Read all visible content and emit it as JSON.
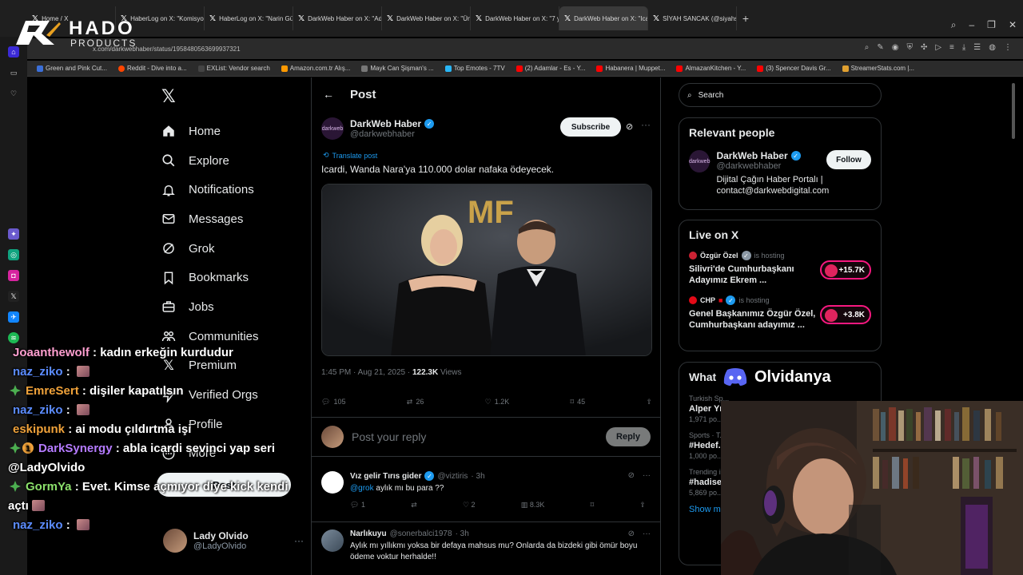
{
  "browser": {
    "tabs": [
      {
        "label": "Home / X"
      },
      {
        "label": "HaberLog on X: \"Komisyo"
      },
      {
        "label": "HaberLog on X: \"Narin Gü"
      },
      {
        "label": "DarkWeb Haber on X: \"Ad"
      },
      {
        "label": "DarkWeb Haber on X: \"Ün"
      },
      {
        "label": "DarkWeb Haber on X: \"7 y"
      },
      {
        "label": "DarkWeb Haber on X: \"Ica"
      },
      {
        "label": "SİYAH SANCAK (@siyahsa"
      }
    ],
    "url": "x.com/darkwebhaber/status/1958480563699937321",
    "bookmarks": [
      {
        "label": "Green and Pink Cut...",
        "color": "#3b6fd8"
      },
      {
        "label": "Reddit - Dive into a...",
        "color": "#ff4500"
      },
      {
        "label": "EXList: Vendor search",
        "color": "#444444"
      },
      {
        "label": "Amazon.com.tr Alış...",
        "color": "#ff9900"
      },
      {
        "label": "Mayk Can Şişman's ...",
        "color": "#777777"
      },
      {
        "label": "Top Emotes - 7TV",
        "color": "#29b6f6"
      },
      {
        "label": "(2) Adamlar - Es - Y...",
        "color": "#ff0000"
      },
      {
        "label": "Habanera | Muppet...",
        "color": "#ff0000"
      },
      {
        "label": "AlmazanKitchen - Y...",
        "color": "#ff0000"
      },
      {
        "label": "(3) Spencer Davis Gr...",
        "color": "#ff0000"
      },
      {
        "label": "StreamerStats.com |...",
        "color": "#e0a030"
      }
    ]
  },
  "logo": {
    "word": "HADO",
    "sub": "PRODUCTS"
  },
  "nav": {
    "items": [
      {
        "label": "Home",
        "icon": "home-icon"
      },
      {
        "label": "Explore",
        "icon": "search-icon"
      },
      {
        "label": "Notifications",
        "icon": "bell-icon"
      },
      {
        "label": "Messages",
        "icon": "envelope-icon"
      },
      {
        "label": "Grok",
        "icon": "grok-icon"
      },
      {
        "label": "Bookmarks",
        "icon": "bookmark-icon"
      },
      {
        "label": "Jobs",
        "icon": "briefcase-icon"
      },
      {
        "label": "Communities",
        "icon": "people-icon"
      },
      {
        "label": "Premium",
        "icon": "x-icon"
      },
      {
        "label": "Verified Orgs",
        "icon": "lightning-icon"
      },
      {
        "label": "Profile",
        "icon": "person-icon"
      },
      {
        "label": "More",
        "icon": "more-circle-icon"
      }
    ],
    "post_label": "Post",
    "profile": {
      "name": "Lady Olvido",
      "handle": "@LadyOlvido"
    }
  },
  "post": {
    "header_title": "Post",
    "author_name": "DarkWeb Haber",
    "author_handle": "@darkwebhaber",
    "avatar_text": "darkweb",
    "subscribe_label": "Subscribe",
    "translate_label": "Translate post",
    "text": "Icardi, Wanda Nara'ya 110.000 dolar nafaka ödeyecek.",
    "time": "1:45 PM · Aug 21, 2025 · ",
    "views": "122.3K",
    "views_label": " Views",
    "stats": {
      "replies": "105",
      "reposts": "26",
      "likes": "1.2K",
      "bookmarks": "45"
    },
    "image_text": "MF"
  },
  "reply_box": {
    "placeholder": "Post your reply",
    "button": "Reply"
  },
  "replies": [
    {
      "name": "Vız gelir Tırıs gider",
      "handle": "@viztiris",
      "time": "· 3h",
      "mention": "@grok",
      "text": " aylık mı bu para ??",
      "stats": {
        "replies": "1",
        "reposts": "",
        "likes": "2",
        "views": "8.3K"
      }
    },
    {
      "name": "Narlıkuyu",
      "handle": "@sonerbalci1978",
      "time": "· 3h",
      "mention": "",
      "text": "Aylık mı yıllıkmı yoksa bir defaya mahsus mu? Onlarda da bizdeki gibi ömür boyu ödeme voktur herhalde!!"
    }
  ],
  "right": {
    "search_placeholder": "Search",
    "relevant_title": "Relevant people",
    "relevant": {
      "name": "DarkWeb Haber",
      "handle": "@darkwebhaber",
      "follow": "Follow",
      "bio": "Dijital Çağın Haber Portalı | contact@darkwebdigital.com"
    },
    "live_title": "Live on X",
    "live": [
      {
        "host": "Özgür Özel",
        "hosting": "is hosting",
        "title": "Silivri'de Cumhurbaşkanı Adayımız Ekrem ...",
        "count": "+15.7K"
      },
      {
        "host": "CHP",
        "hosting": "is hosting",
        "title": "Genel Başkanımız Özgür Özel, Cumhurbaşkanı adayımız ...",
        "count": "+3.8K"
      }
    ],
    "whats_title": "What",
    "trends": [
      {
        "sub": "Turkish Sp...",
        "name": "Alper Yı...",
        "count": "1,971 po..."
      },
      {
        "sub": "Sports · T...",
        "name": "#Hedef...",
        "count": "1,000 po..."
      },
      {
        "sub": "Trending i...",
        "name": "#hadise...",
        "count": "5,869 po..."
      }
    ],
    "show_more": "Show m..."
  },
  "chat": [
    {
      "user": "Joaanthewolf",
      "color": "#ff9fd0",
      "msg": " : kadın erkeğin kurdudur",
      "emote": false
    },
    {
      "user": "naz_ziko",
      "color": "#5b8cff",
      "msg": " : ",
      "emote": true
    },
    {
      "user": "EmreSert",
      "color": "#f0a23a",
      "msg": " : dişiler kapatılsın",
      "emote": false
    },
    {
      "user": "naz_ziko",
      "color": "#5b8cff",
      "msg": " : ",
      "emote": true
    },
    {
      "user": "eskipunk",
      "color": "#f0a23a",
      "msg": " : ai modu çıldırtma işi",
      "emote": false
    },
    {
      "user": "DarkSynergy",
      "color": "#b57bff",
      "msg": " : abla icardi sevinci yap seri @LadyOlvido",
      "emote": false
    },
    {
      "user": "GormYa",
      "color": "#8be06b",
      "msg": " : Evet. Kimse açmıyor diye kick kendi açtı",
      "emote": true
    },
    {
      "user": "naz_ziko",
      "color": "#5b8cff",
      "msg": " : ",
      "emote": true
    }
  ],
  "discord": {
    "name": "Olvidanya"
  },
  "colors": {
    "accent": "#1d9bf0",
    "live": "#f91880",
    "bg": "#000000"
  }
}
